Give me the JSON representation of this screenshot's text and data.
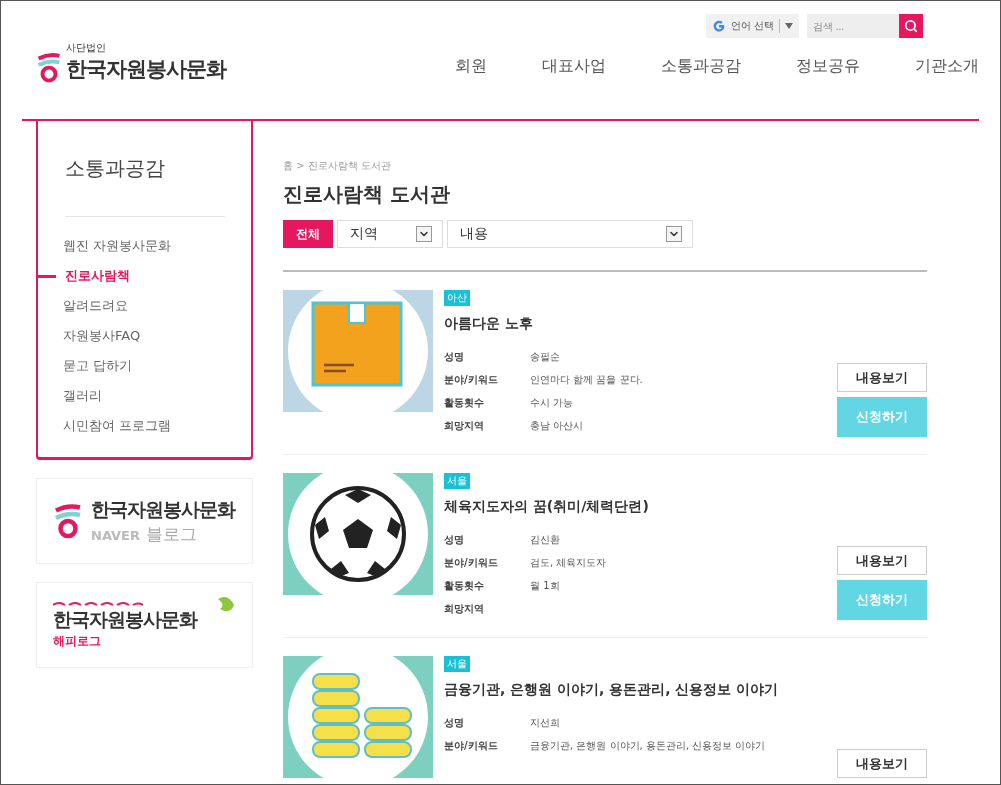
{
  "logo": {
    "caption": "사단법인",
    "name": "한국자원봉사문화"
  },
  "language": {
    "label": "언어 선택"
  },
  "search": {
    "placeholder": "검색 ..."
  },
  "nav": [
    "회원",
    "대표사업",
    "소통과공감",
    "정보공유",
    "기관소개"
  ],
  "sidebar": {
    "title": "소통과공감",
    "items": [
      {
        "label": "웹진 자원봉사문화",
        "selected": false
      },
      {
        "label": "진로사람책",
        "selected": true
      },
      {
        "label": "알려드려요",
        "selected": false
      },
      {
        "label": "자원봉사FAQ",
        "selected": false
      },
      {
        "label": "묻고 답하기",
        "selected": false
      },
      {
        "label": "갤러리",
        "selected": false
      },
      {
        "label": "시민참여 프로그램",
        "selected": false
      }
    ]
  },
  "banners": [
    {
      "kind": "naver",
      "title": "한국자원봉사문화",
      "brand": "NAVER",
      "service": "블로그"
    },
    {
      "kind": "happylog",
      "title": "한국자원봉사문화",
      "service": "해피로그"
    }
  ],
  "breadcrumb": "홈 > 진로사람책 도서관",
  "heading": "진로사람책 도서관",
  "filters": {
    "all": "전체",
    "region": "지역",
    "content": "내용"
  },
  "books": [
    {
      "kind": "box",
      "tag": "아산",
      "title": "아름다운 노후",
      "fields": [
        {
          "label": "성명",
          "value": "송필순"
        },
        {
          "label": "분야/키워드",
          "value": "인연마다 함께 꿈을 꾼다."
        },
        {
          "label": "활동횟수",
          "value": "수시 가능"
        },
        {
          "label": "희망지역",
          "value": "충남 아산시"
        }
      ],
      "buttons": [
        "내용보기",
        "신청하기"
      ]
    },
    {
      "kind": "ball",
      "tag": "서울",
      "title": "체육지도자의 꿈(취미/체력단련)",
      "fields": [
        {
          "label": "성명",
          "value": "김신환"
        },
        {
          "label": "분야/키워드",
          "value": "검도, 체육지도자"
        },
        {
          "label": "활동횟수",
          "value": "월 1회"
        },
        {
          "label": "희망지역"
        }
      ],
      "buttons": [
        "내용보기",
        "신청하기"
      ]
    },
    {
      "kind": "coins",
      "tag": "서울",
      "title": "금융기관, 은행원 이야기, 용돈관리, 신용정보 이야기",
      "fields": [
        {
          "label": "성명",
          "value": "지선희"
        },
        {
          "label": "분야/키워드",
          "value": "금융기관, 은행원 이야기, 용돈관리, 신용정보 이야기"
        }
      ],
      "buttons": [
        "내용보기"
      ]
    }
  ]
}
